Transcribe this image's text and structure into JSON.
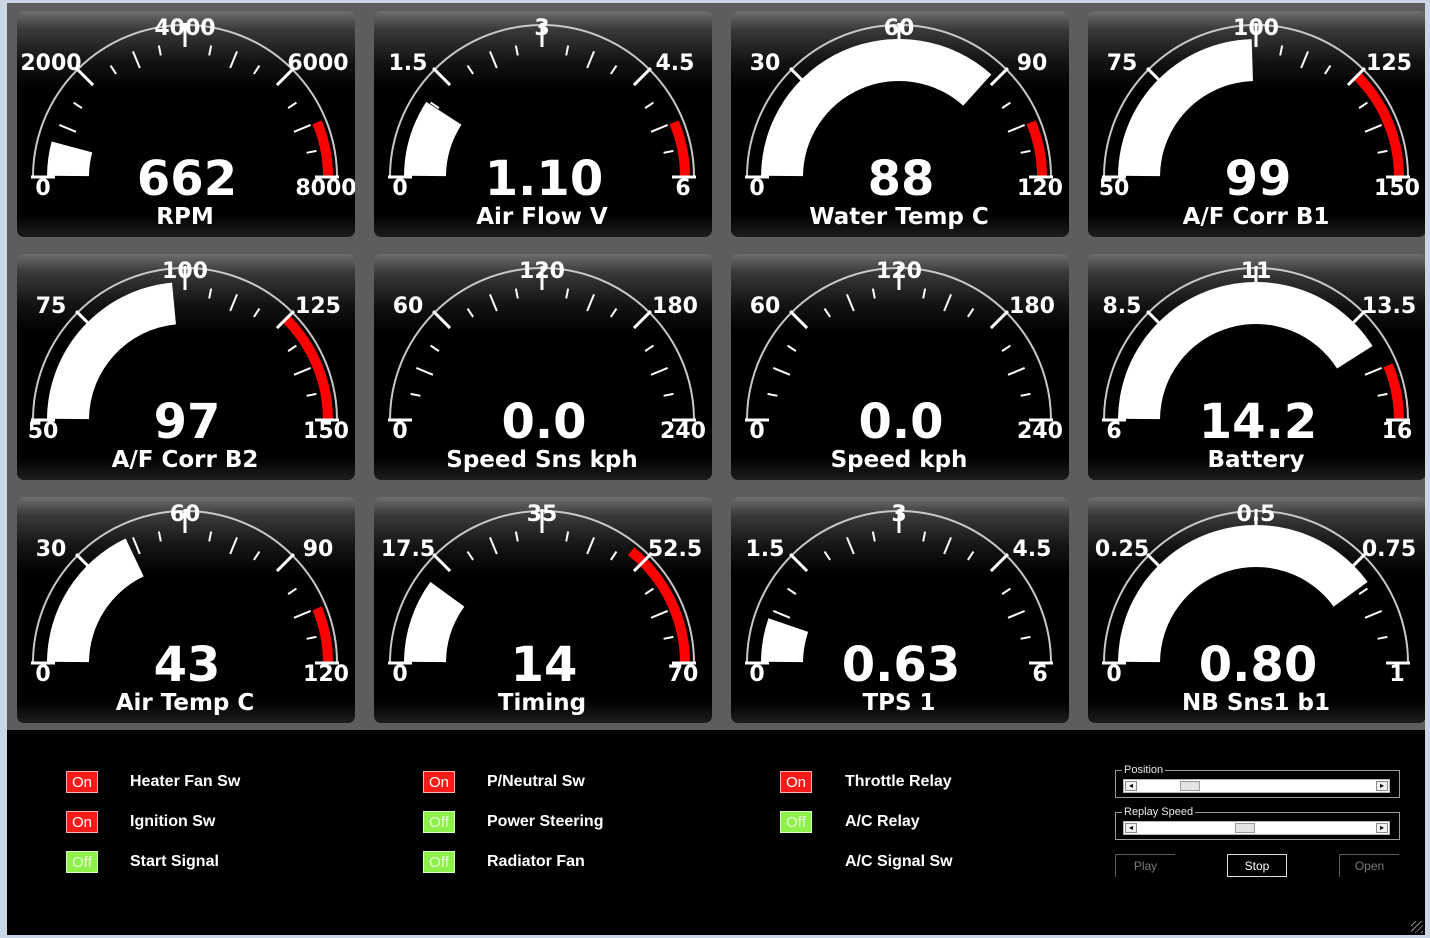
{
  "gauges": [
    {
      "id": "rpm",
      "label": "RPM",
      "value_text": "662",
      "value": 662,
      "min": 0,
      "max": 8000,
      "tick_labels": [
        "0",
        "2000",
        "4000",
        "6000",
        "8000"
      ],
      "redline_start": 7000,
      "redline_end": 8000
    },
    {
      "id": "airflow",
      "label": "Air Flow V",
      "value_text": "1.10",
      "value": 1.1,
      "min": 0,
      "max": 6,
      "tick_labels": [
        "0",
        "1.5",
        "3",
        "4.5",
        "6"
      ],
      "redline_start": 5.25,
      "redline_end": 6
    },
    {
      "id": "watertemp",
      "label": "Water Temp C",
      "value_text": "88",
      "value": 88,
      "min": 0,
      "max": 120,
      "tick_labels": [
        "0",
        "30",
        "60",
        "90",
        "120"
      ],
      "redline_start": 105,
      "redline_end": 120
    },
    {
      "id": "afcorrb1",
      "label": "A/F Corr B1",
      "value_text": "99",
      "value": 99,
      "min": 50,
      "max": 150,
      "tick_labels": [
        "50",
        "75",
        "100",
        "125",
        "150"
      ],
      "redline_start": 125,
      "redline_end": 150
    },
    {
      "id": "afcorrb2",
      "label": "A/F Corr B2",
      "value_text": "97",
      "value": 97,
      "min": 50,
      "max": 150,
      "tick_labels": [
        "50",
        "75",
        "100",
        "125",
        "150"
      ],
      "redline_start": 125,
      "redline_end": 150
    },
    {
      "id": "speedsns",
      "label": "Speed Sns kph",
      "value_text": "0.0",
      "value": 0,
      "min": 0,
      "max": 240,
      "tick_labels": [
        "0",
        "60",
        "120",
        "180",
        "240"
      ],
      "redline_start": null,
      "redline_end": null
    },
    {
      "id": "speed",
      "label": "Speed kph",
      "value_text": "0.0",
      "value": 0,
      "min": 0,
      "max": 240,
      "tick_labels": [
        "0",
        "60",
        "120",
        "180",
        "240"
      ],
      "redline_start": null,
      "redline_end": null
    },
    {
      "id": "battery",
      "label": "Battery",
      "value_text": "14.2",
      "value": 14.2,
      "min": 6,
      "max": 16,
      "tick_labels": [
        "6",
        "8.5",
        "11",
        "13.5",
        "16"
      ],
      "redline_start": 14.75,
      "redline_end": 16
    },
    {
      "id": "airtemp",
      "label": "Air Temp C",
      "value_text": "43",
      "value": 43,
      "min": 0,
      "max": 120,
      "tick_labels": [
        "0",
        "30",
        "60",
        "90",
        "120"
      ],
      "redline_start": 105,
      "redline_end": 120
    },
    {
      "id": "timing",
      "label": "Timing",
      "value_text": "14",
      "value": 14,
      "min": 0,
      "max": 70,
      "tick_labels": [
        "0",
        "17.5",
        "35",
        "52.5",
        "70"
      ],
      "redline_start": 50,
      "redline_end": 70
    },
    {
      "id": "tps1",
      "label": "TPS 1",
      "value_text": "0.63",
      "value": 0.63,
      "min": 0,
      "max": 6,
      "tick_labels": [
        "0",
        "1.5",
        "3",
        "4.5",
        "6"
      ],
      "redline_start": null,
      "redline_end": null
    },
    {
      "id": "nbsns1b1",
      "label": "NB Sns1 b1",
      "value_text": "0.80",
      "value": 0.8,
      "min": 0,
      "max": 1,
      "tick_labels": [
        "0",
        "0.25",
        "0.5",
        "0.75",
        "1"
      ],
      "redline_start": null,
      "redline_end": null
    }
  ],
  "indicators": [
    [
      {
        "state": "On",
        "label": "Heater Fan Sw"
      },
      {
        "state": "On",
        "label": "Ignition Sw"
      },
      {
        "state": "Off",
        "label": "Start Signal"
      }
    ],
    [
      {
        "state": "On",
        "label": "P/Neutral Sw"
      },
      {
        "state": "Off",
        "label": "Power Steering"
      },
      {
        "state": "Off",
        "label": "Radiator Fan"
      }
    ],
    [
      {
        "state": "On",
        "label": "Throttle Relay"
      },
      {
        "state": "Off",
        "label": "A/C Relay"
      },
      {
        "state": null,
        "label": "A/C Signal Sw"
      }
    ]
  ],
  "controls": {
    "position_title": "Position",
    "position_value": 0.2,
    "replay_speed_title": "Replay Speed",
    "replay_speed_value": 0.45,
    "play_label": "Play",
    "stop_label": "Stop",
    "open_label": "Open",
    "left_arrow": "◂",
    "right_arrow": "▸"
  },
  "colors": {
    "redline": "#ff0000",
    "indicator_on": "#ff1a1a",
    "indicator_off": "#8ef04a",
    "needle_fill": "#ffffff"
  }
}
